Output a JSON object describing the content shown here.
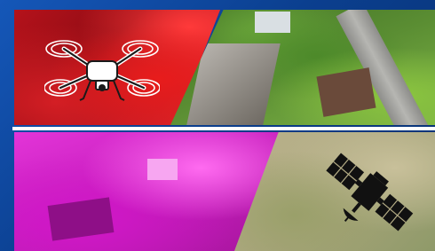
{
  "colors": {
    "frame_blue": "#0b3f8f",
    "panel_red": "#d01a22",
    "panel_magenta": "#d62bcc",
    "panel_beige": "#b5ad86"
  },
  "panels": [
    {
      "name": "drone-panel",
      "icon": "drone-icon"
    },
    {
      "name": "aerial-photo-panel",
      "icon": ""
    },
    {
      "name": "infrared-photo-panel",
      "icon": ""
    },
    {
      "name": "satellite-panel",
      "icon": "satellite-icon"
    }
  ]
}
